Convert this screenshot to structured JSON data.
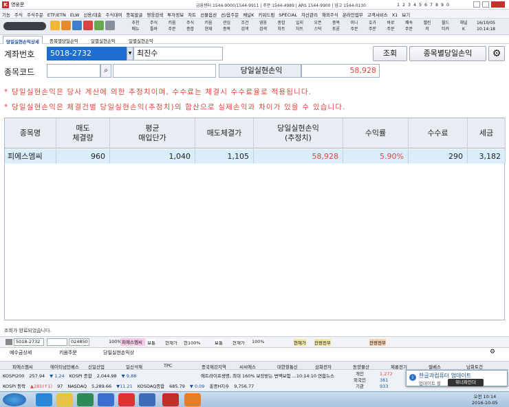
{
  "window": {
    "title": "영웅문",
    "info": "금융센터 1544-9000/1544-9911 | 주문 1544-4989 | ARS 1544-9900 | 업고 1544-0130",
    "pages": [
      "1",
      "2",
      "3",
      "4",
      "5",
      "6",
      "7",
      "8",
      "9",
      "0"
    ]
  },
  "menu": [
    "기능",
    "주식",
    "주식주문",
    "ETF/ETN",
    "ELW",
    "신용/대출",
    "주식대여",
    "종목발굴",
    "영웅검색",
    "투자정보",
    "차트",
    "선물옵션",
    "선/옵주문",
    "채널K",
    "키워드림",
    "SPECIAL",
    "자산관리",
    "해외주식",
    "온라인업무",
    "고객서비스",
    "X1",
    "보기"
  ],
  "toolbar": {
    "buttons": [
      [
        "추천",
        "메뉴"
      ],
      [
        "주식",
        "틀바"
      ],
      [
        "키움",
        "주문"
      ],
      [
        "주식",
        "종합"
      ],
      [
        "키움",
        "현재"
      ],
      [
        "관심",
        "종목"
      ],
      [
        "조건",
        "검색"
      ],
      [
        "영웅",
        "검색"
      ],
      [
        "종합",
        "차트"
      ],
      [
        "일지",
        "차트"
      ],
      [
        "오픈",
        "스탁"
      ],
      [
        "종목",
        "토론"
      ],
      [
        "미니",
        "주문"
      ],
      [
        "호가",
        "주문"
      ],
      [
        "바로",
        "주문"
      ],
      [
        "쾌속",
        "주문"
      ],
      [
        "챌린",
        "저"
      ],
      [
        "월드",
        "티커"
      ],
      [
        "채널",
        "K"
      ]
    ],
    "date": "16/10/05",
    "time": "10:14:18"
  },
  "tabs1": [
    "당일실현손익상세",
    "종목별당일손익",
    "일별실현손익",
    "일별실현손익"
  ],
  "form": {
    "account_label": "계좌번호",
    "account_value": "5018-2732",
    "holder": "최진수",
    "stock_label": "종목코드",
    "realized_label": "당일실현손익",
    "realized_value": "58,928",
    "query_btn": "조회",
    "bystock_btn": "종목별당일손익"
  },
  "notes": [
    "* 당일실현손익은 당사 계산에 의한 추정치이며, 수수료는 체결시 수수료율로 적용됩니다.",
    "* 당일실현손익은 체결건별 당일실현손익(추정치)의 합산으로 실제손익과 차이가 있을 수 있습니다."
  ],
  "table": {
    "headers": [
      [
        "종목명"
      ],
      [
        "매도",
        "체결량"
      ],
      [
        "평균",
        "매입단가"
      ],
      [
        "매도체결가"
      ],
      [
        "당일실현손익",
        "(추정치)"
      ],
      [
        "수익률"
      ],
      [
        "수수료"
      ],
      [
        "세금"
      ]
    ],
    "rows": [
      [
        "피에스엠씨",
        "960",
        "1,040",
        "1,105",
        "58,928",
        "5.90%",
        "290",
        "3,182"
      ]
    ]
  },
  "status": "조회가 완료되었습니다.",
  "bottom": {
    "code": "5018-2732",
    "code2": "024850",
    "pct": "100%",
    "name": "피에스엠씨",
    "items": [
      "보통",
      "현재가",
      "현100%",
      "보통",
      "현재가",
      "100%",
      "현재가",
      "잔량전부",
      "잔량전부"
    ]
  },
  "bottom_tabs": [
    "예수금상세",
    "키움주문",
    "당일실현손익상"
  ],
  "ticker_header": [
    "피에스엠씨",
    "에이티넘인베스",
    "신일산업",
    "일신석재",
    "TPC",
    "종국제강지역",
    "씨씨에스",
    "대한항통신",
    "삼화전자",
    "동양물산",
    "제룡전기",
    "럴베스",
    "남화토건"
  ],
  "ticker": [
    [
      "KOSPI200",
      "257.94",
      "▼ 1.24",
      "KOSPI 종합",
      "2,044.98",
      "▼ 9.88"
    ],
    [
      "KOSPI 등락",
      "▲281(↑1)",
      "97",
      "NASDAQ",
      "5,289.66",
      "▼11.21",
      "KOSDAQ종합",
      "685.79",
      "▼ 0.09",
      "홍콩H지수",
      "9,756.77"
    ]
  ],
  "news": "에트라이프생명, 최대 160% 보장받는 변액보험 ...10:14:10  연합뉴스",
  "side": {
    "l1": "개인",
    "l2": "외국인",
    "l3": "기관",
    "n1": "1,272",
    "n2": "361",
    "n3": "933"
  },
  "popup": {
    "title": "한글과컴퓨터 업데이트",
    "sub": "업데이트 할",
    "badge": "위너파인더"
  },
  "clock": {
    "time": "오전 10:14",
    "date": "2016-10-05"
  },
  "colors": {
    "red": "#e2463a",
    "blue": "#1a4fa0",
    "header": "#e8edf3",
    "row": "#d9eefa"
  }
}
